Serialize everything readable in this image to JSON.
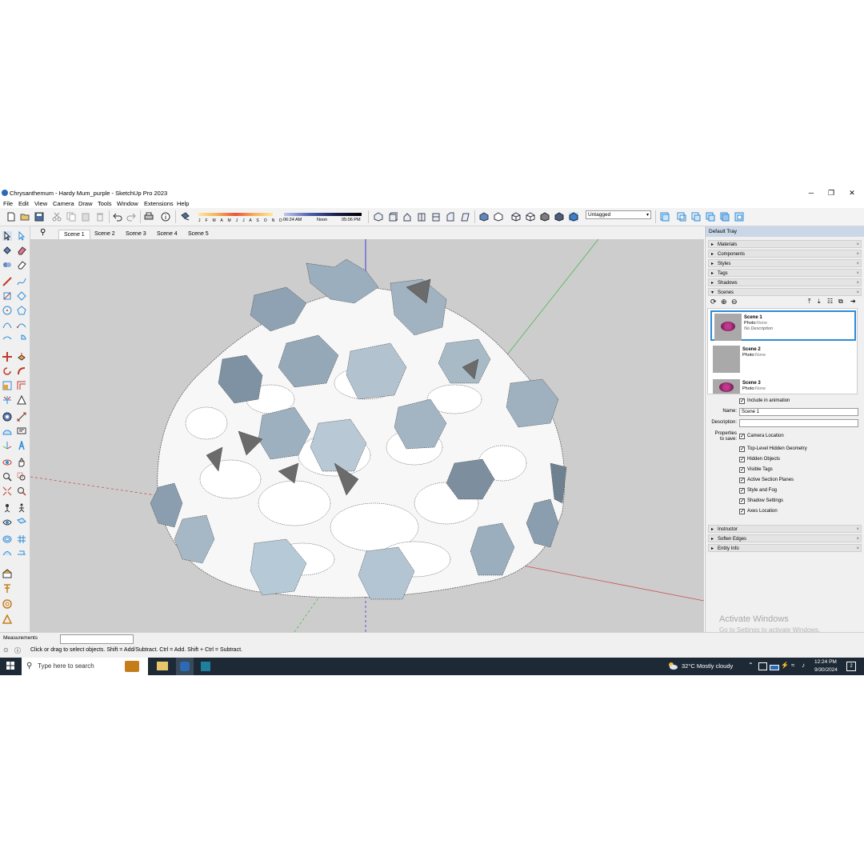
{
  "window": {
    "title": "Chrysanthemum - Hardy Mum_purple - SketchUp Pro 2023",
    "minimize_glyph": "─",
    "restore_glyph": "❐",
    "close_glyph": "✕"
  },
  "menu": [
    "File",
    "Edit",
    "View",
    "Camera",
    "Draw",
    "Tools",
    "Window",
    "Extensions",
    "Help"
  ],
  "shadow": {
    "months": "J F M A M J J A S O N D",
    "time_start": "06:24 AM",
    "time_noon": "Noon",
    "time_end": "05:06 PM"
  },
  "tags": {
    "selected": "Untagged"
  },
  "scene_tabs": [
    "Scene 1",
    "Scene 2",
    "Scene 3",
    "Scene 4",
    "Scene 5"
  ],
  "tray": {
    "title": "Default Tray",
    "panels_top": [
      "Materials",
      "Components",
      "Styles",
      "Tags",
      "Shadows",
      "Scenes"
    ],
    "panels_bottom": [
      "Instructor",
      "Soften Edges",
      "Entity Info"
    ],
    "scenes": [
      {
        "name": "Scene 1",
        "photo_label": "Photo:",
        "photo_value": "None",
        "description": "No Description"
      },
      {
        "name": "Scene 2",
        "photo_label": "Photo:",
        "photo_value": "None",
        "description": ""
      },
      {
        "name": "Scene 3",
        "photo_label": "Photo:",
        "photo_value": "None",
        "description": ""
      }
    ],
    "include_in_animation": "Include in animation",
    "name_label": "Name:",
    "name_value": "Scene 1",
    "description_label": "Description:",
    "description_value": "",
    "properties_label_1": "Properties",
    "properties_label_2": "to save:",
    "properties": [
      "Camera Location",
      "Top-Level Hidden Geometry",
      "Hidden Objects",
      "Visible Tags",
      "Active Section Planes",
      "Style and Fog",
      "Shadow Settings",
      "Axes Location"
    ]
  },
  "watermark": {
    "line1": "Activate Windows",
    "line2": "Go to Settings to activate Windows."
  },
  "measurements": {
    "label": "Measurements",
    "value": ""
  },
  "status": {
    "text": "Click or drag to select objects. Shift = Add/Subtract. Ctrl = Add. Shift + Ctrl = Subtract."
  },
  "taskbar": {
    "search_placeholder": "Type here to search",
    "weather": "32°C  Mostly cloudy",
    "time": "12:24 PM",
    "date": "9/30/2024",
    "notification_count": "2"
  },
  "colors": {
    "viewport_bg": "#cdcdcd",
    "axis_blue": "#3a3ad6",
    "axis_green": "#4cb84c",
    "axis_red": "#c85050",
    "selection": "#2d8bd7"
  }
}
